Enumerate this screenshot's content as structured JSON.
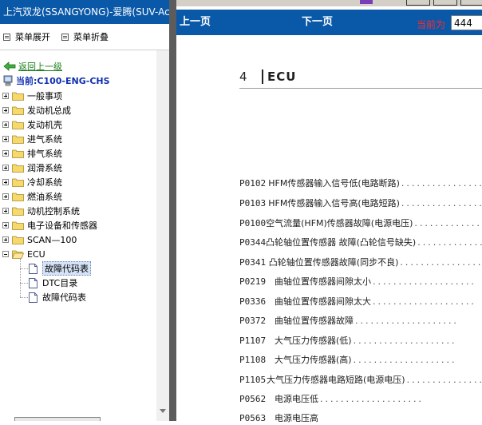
{
  "left_panel": {
    "title": "上汽双龙(SSANGYONG)-爱腾(SUV-Act",
    "menu_expand": "菜单展开",
    "menu_collapse": "菜单折叠",
    "back_link": "返回上一级",
    "current": "当前:C100-ENG-CHS",
    "tree": [
      {
        "label": "一般事项"
      },
      {
        "label": "发动机总成"
      },
      {
        "label": "发动机壳"
      },
      {
        "label": "进气系统"
      },
      {
        "label": "排气系统"
      },
      {
        "label": "润滑系统"
      },
      {
        "label": "冷却系统"
      },
      {
        "label": "燃油系统"
      },
      {
        "label": "动机控制系统"
      },
      {
        "label": "电子设备和传感器"
      },
      {
        "label": "SCAN—100"
      },
      {
        "label": "ECU"
      }
    ],
    "ecu_children": [
      {
        "label": "故障代码表",
        "selected": true
      },
      {
        "label": "DTC目录",
        "selected": false
      },
      {
        "label": "故障代码表",
        "selected": false
      }
    ]
  },
  "navbar": {
    "prev": "上一页",
    "next": "下一页",
    "page_label": "当前为",
    "page_value": "444"
  },
  "document": {
    "section_number": "4",
    "section_title": "ECU",
    "dtc_list": [
      {
        "code": "P0102",
        "desc": "HFM传感器输入信号低(电路断路)"
      },
      {
        "code": "P0103",
        "desc": "HFM传感器输入信号高(电路短路)"
      },
      {
        "code": "P0100",
        "desc": "空气流量(HFM)传感器故障(电源电压)"
      },
      {
        "code": "P0344",
        "desc": "凸轮轴位置传感器 故障(凸轮信号缺失)"
      },
      {
        "code": "P0341",
        "desc": "凸轮轴位置传感器故障(同步不良)"
      },
      {
        "code": "P0219",
        "desc": "曲轴位置传感器间隙太小"
      },
      {
        "code": "P0336",
        "desc": "曲轴位置传感器间隙太大"
      },
      {
        "code": "P0372",
        "desc": "曲轴位置传感器故障"
      },
      {
        "code": "P1107",
        "desc": "大气压力传感器(低)"
      },
      {
        "code": "P1108",
        "desc": "大气压力传感器(高)"
      },
      {
        "code": "P1105",
        "desc": "大气压力传感器电路短路(电源电压)"
      },
      {
        "code": "P0562",
        "desc": "电源电压低"
      },
      {
        "code": "P0563",
        "desc": "电源电压高"
      }
    ]
  },
  "icons": {
    "back": "green-arrow-left-icon",
    "current": "computer-icon",
    "folder_closed": "folder-icon",
    "folder_open": "folder-open-icon",
    "document": "document-icon",
    "menu": "list-icon"
  },
  "colors": {
    "title_bar": "#0a58a8",
    "link_green": "#1a7d1a",
    "current_blue": "#1030b0",
    "page_label_red": "#ff2a2a",
    "splitter": "#5c5c5c"
  }
}
